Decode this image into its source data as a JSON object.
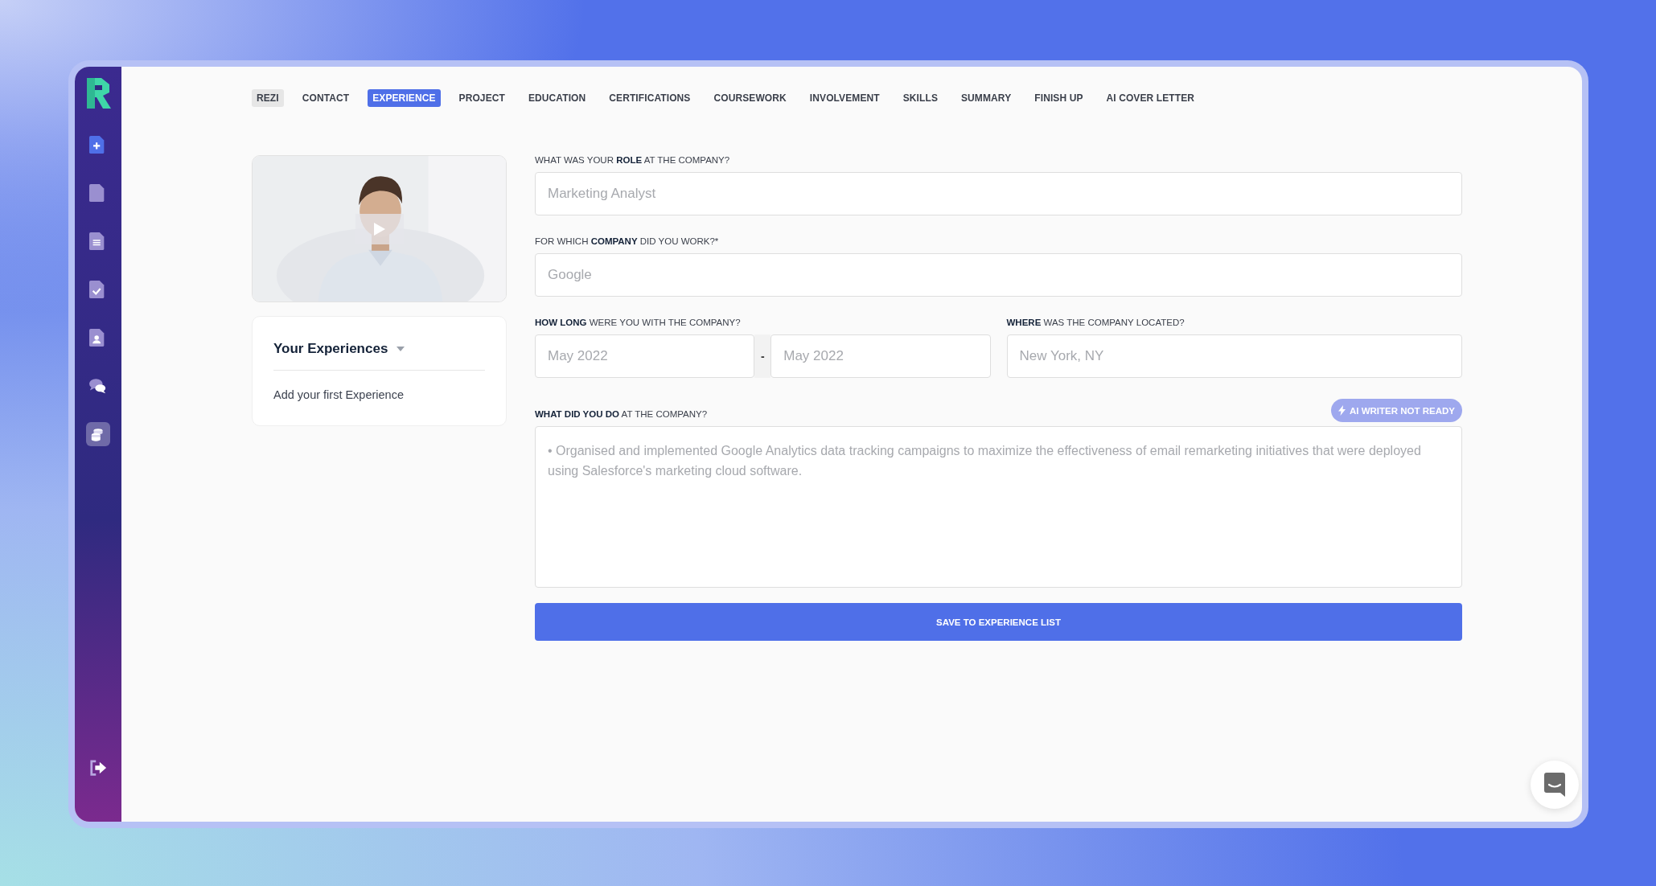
{
  "sidebar": {
    "items": [
      {
        "kind": "new",
        "selected": false
      },
      {
        "kind": "file",
        "selected": false
      },
      {
        "kind": "lines",
        "selected": false
      },
      {
        "kind": "check",
        "selected": false
      },
      {
        "kind": "person",
        "selected": false
      },
      {
        "kind": "chat",
        "selected": false
      },
      {
        "kind": "stack",
        "selected": true
      }
    ],
    "footer": {
      "kind": "logout"
    }
  },
  "tabs": [
    {
      "label": "REZI",
      "kind": "brand",
      "selected": false
    },
    {
      "label": "CONTACT",
      "kind": "step",
      "selected": false
    },
    {
      "label": "EXPERIENCE",
      "kind": "step",
      "selected": true
    },
    {
      "label": "PROJECT",
      "kind": "step",
      "selected": false
    },
    {
      "label": "EDUCATION",
      "kind": "step",
      "selected": false
    },
    {
      "label": "CERTIFICATIONS",
      "kind": "step",
      "selected": false
    },
    {
      "label": "COURSEWORK",
      "kind": "step",
      "selected": false
    },
    {
      "label": "INVOLVEMENT",
      "kind": "step",
      "selected": false
    },
    {
      "label": "SKILLS",
      "kind": "step",
      "selected": false
    },
    {
      "label": "SUMMARY",
      "kind": "step",
      "selected": false
    },
    {
      "label": "FINISH UP",
      "kind": "step",
      "selected": false
    },
    {
      "label": "AI COVER LETTER",
      "kind": "step",
      "selected": false
    }
  ],
  "experiences": {
    "title": "Your Experiences",
    "empty_text": "Add your first Experience"
  },
  "form": {
    "role": {
      "label": "WHAT WAS YOUR **ROLE** AT THE COMPANY?",
      "placeholder": "Marketing Analyst"
    },
    "company": {
      "label": "FOR WHICH **COMPANY** DID YOU WORK?*",
      "placeholder": "Google"
    },
    "duration": {
      "label": "**HOW LONG** WERE YOU WITH THE COMPANY?",
      "start_placeholder": "May 2022",
      "separator": "-",
      "end_placeholder": "May 2022"
    },
    "location": {
      "label": "**WHERE** WAS THE COMPANY LOCATED?",
      "placeholder": "New York, NY"
    },
    "description": {
      "label": "**WHAT DID YOU DO** AT THE COMPANY?",
      "placeholder": "• Organised and implemented Google Analytics data tracking campaigns to maximize the effectiveness of email remarketing initiatives that were deployed using Salesforce's marketing cloud software."
    },
    "ai_button": {
      "label": "AI WRITER NOT READY",
      "disabled": true
    },
    "save_button": {
      "label": "SAVE TO EXPERIENCE LIST"
    }
  }
}
